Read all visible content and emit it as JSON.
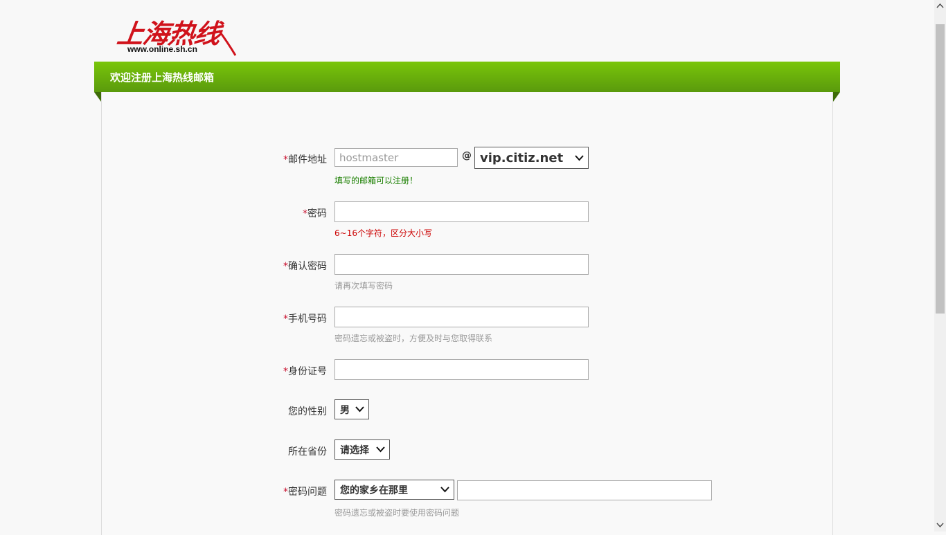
{
  "logo": {
    "chinese": "上海热线",
    "url": "www.online.sh.cn"
  },
  "header": {
    "title": "欢迎注册上海热线邮箱"
  },
  "form": {
    "required_mark": "*",
    "email": {
      "label": "邮件地址",
      "placeholder": "hostmaster",
      "at": "@",
      "domain_selected": "vip.citiz.net",
      "hint": "填写的邮箱可以注册！"
    },
    "password": {
      "label": "密码",
      "hint": "6~16个字符，区分大小写"
    },
    "confirm_password": {
      "label": "确认密码",
      "hint": "请再次填写密码"
    },
    "phone": {
      "label": "手机号码",
      "hint": "密码遗忘或被盗时，方便及时与您取得联系"
    },
    "id_card": {
      "label": "身份证号"
    },
    "gender": {
      "label": "您的性别",
      "selected": "男"
    },
    "province": {
      "label": "所在省份",
      "selected": "请选择"
    },
    "security_question": {
      "label": "密码问题",
      "selected": "您的家乡在那里",
      "hint": "密码遗忘或被盗时要使用密码问题"
    }
  },
  "colors": {
    "header_green": "#6eb80b",
    "required_red": "#c8102e",
    "hint_green": "#1a7f00",
    "hint_red": "#cc0000",
    "hint_gray": "#999999"
  }
}
